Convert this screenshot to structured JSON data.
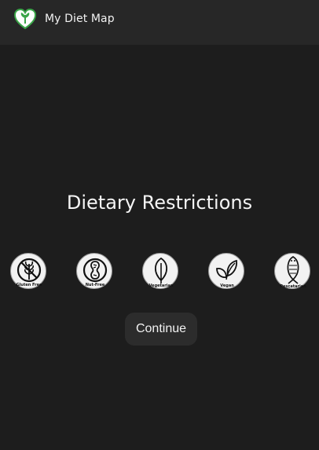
{
  "header": {
    "app_name": "My Diet Map",
    "logo_icon": "heart-leaf-logo-icon"
  },
  "main": {
    "title": "Dietary Restrictions",
    "options": [
      {
        "label": "Gluten Free",
        "icon": "wheat-icon"
      },
      {
        "label": "Nut-Free",
        "icon": "peanut-icon"
      },
      {
        "label": "Vegetarian",
        "icon": "leaf-icon"
      },
      {
        "label": "Vegan",
        "icon": "two-leaves-icon"
      },
      {
        "label": "Pescatarian",
        "icon": "fish-icon"
      }
    ],
    "continue_label": "Continue"
  },
  "colors": {
    "background": "#1d1d1d",
    "header": "#272727",
    "logo_green": "#3aa548",
    "option_fill": "#f2f2f2",
    "button": "#2c2c2c"
  }
}
